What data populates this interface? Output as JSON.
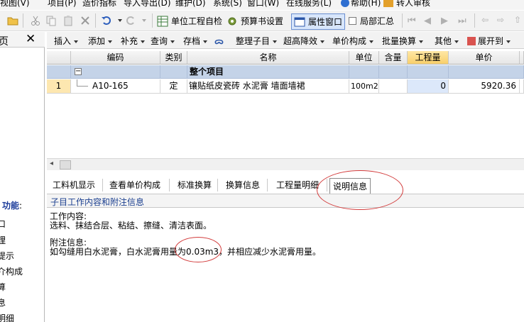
{
  "menubar": {
    "items": [
      "视图(V)",
      "项目(P)",
      "造价指标",
      "导入导出(D)",
      "维护(D)",
      "系统(S)",
      "窗口(W)",
      "在线服务(L)",
      "帮助(H)",
      "转人审核"
    ]
  },
  "toolbar1": {
    "self_check": "单位工程自检",
    "budget_settings": "预算书设置",
    "property_window": "属性窗口",
    "partial_summary": "局部汇总"
  },
  "toolbar2": {
    "insert": "插入",
    "add": "添加",
    "supplement": "补充",
    "query": "查询",
    "archive": "存档",
    "organize": "整理子目",
    "super_high": "超高降效",
    "unit_price_comp": "单价构成",
    "batch_convert": "批量换算",
    "other": "其他",
    "expand_to": "展开到"
  },
  "left_panel": {
    "title": "页",
    "close": "✕",
    "function_label": "功能",
    "function_colon": ":",
    "items": [
      "口",
      "理",
      "提示",
      "介构成",
      "算",
      "息",
      "明细"
    ]
  },
  "grid": {
    "columns": [
      "编码",
      "类别",
      "名称",
      "单位",
      "含量",
      "工程量",
      "单价"
    ],
    "group_row": {
      "toggle": "−",
      "name": "整个项目"
    },
    "rows": [
      {
        "index": "1",
        "code": "A10-165",
        "category": "定",
        "name": "镶贴纸皮瓷砖 水泥膏 墙面墙裙",
        "unit": "100m2",
        "content": "",
        "quantity": "0",
        "price": "5920.36"
      }
    ]
  },
  "tabs": [
    "工料机显示",
    "查看单价构成",
    "标准换算",
    "换算信息",
    "工程量明细",
    "说明信息"
  ],
  "active_tab_index": 5,
  "info": {
    "header": "子目工作内容和附注信息",
    "work_title": "工作内容:",
    "work_text": "选料、抹结合层、粘结、擦缝、清洁表面。",
    "note_title": "附注信息:",
    "note_text": "如勾缝用白水泥膏，白水泥膏用量为0.03m3，并相应减少水泥膏用量。"
  },
  "colors": {
    "group_row": "#c4d3e8",
    "active_column": "#f8cf6a",
    "annotation": "#d23b3b",
    "info_header_text": "#1b3f8f"
  }
}
